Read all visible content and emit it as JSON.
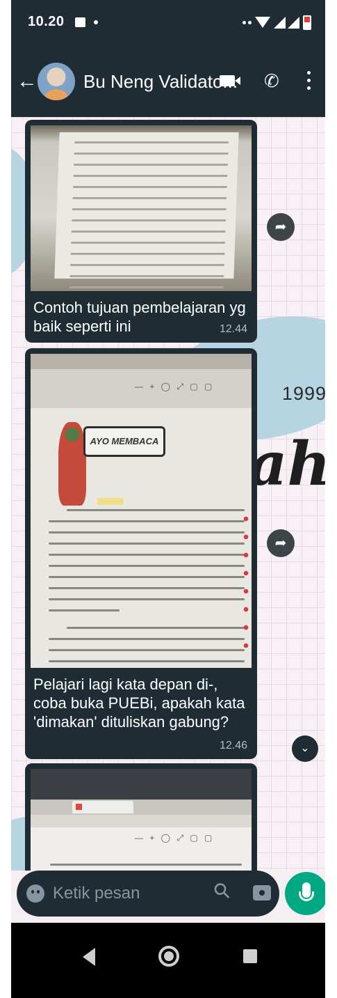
{
  "status_bar": {
    "time": "10.20",
    "icons": [
      "image-notification-icon",
      "dot-icon",
      "wifi-icon",
      "signal-icon",
      "battery-icon"
    ]
  },
  "header": {
    "contact_name": "Bu Neng Validato...",
    "icons": [
      "back-arrow-icon",
      "avatar",
      "video-call-icon",
      "voice-call-icon",
      "more-options-icon"
    ]
  },
  "wallpaper": {
    "year_text": "1999",
    "script_text": "ah"
  },
  "messages": [
    {
      "caption": "Contoh tujuan pembelajaran yg baik seperti ini",
      "time": "12.44"
    },
    {
      "image_heading": "AYO MEMBACA",
      "caption": "Pelajari lagi kata depan di-, coba buka PUEBi, apakah kata 'dimakan' dituliskan gabung?",
      "time": "12.46"
    },
    {
      "caption": "",
      "time": ""
    }
  ],
  "composer": {
    "placeholder": "Ketik pesan"
  },
  "colors": {
    "header_bg": "#1f2c34",
    "bubble_bg": "#1f2c34",
    "accent": "#00a884",
    "icon_grey": "#8696a0"
  }
}
